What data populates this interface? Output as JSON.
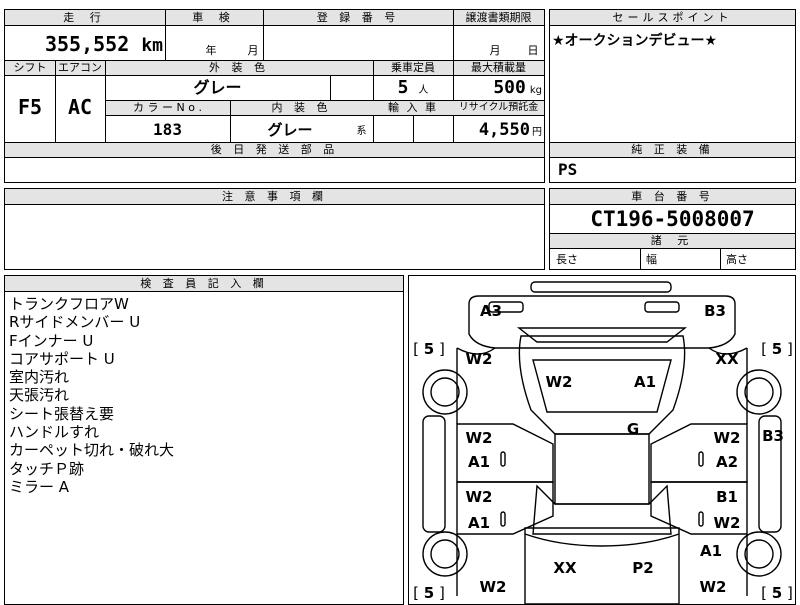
{
  "top_row": {
    "mileage_label": "走 行",
    "inspection_label": "車 検",
    "registration_label": "登 録 番 号",
    "transfer_doc_label": "譲渡書類期限",
    "sales_point_label": "セールスポイント"
  },
  "mileage": {
    "value": "355,552",
    "unit": "km"
  },
  "inspection": {
    "year_unit": "年",
    "month_unit": "月"
  },
  "transfer_doc": {
    "month_unit": "月",
    "day_unit": "日"
  },
  "sales_point": {
    "text": "★オークションデビュー★"
  },
  "row2_labels": {
    "shift": "シフト",
    "aircon": "エアコン",
    "exterior_color": "外 装 色",
    "capacity": "乗車定員",
    "max_load": "最大積載量"
  },
  "shift": {
    "value": "F5"
  },
  "aircon": {
    "value": "AC"
  },
  "exterior_color": {
    "value": "グレー"
  },
  "capacity": {
    "value": "5",
    "unit": "人"
  },
  "max_load": {
    "value": "500",
    "unit": "kg"
  },
  "row3_labels": {
    "color_no": "カ ラ ー N o .",
    "interior_color": "内 装 色",
    "import": "輸 入 車",
    "recycle": "リサイクル預託金"
  },
  "color_no": {
    "value": "183"
  },
  "interior_color": {
    "value": "グレー",
    "suffix": "系"
  },
  "recycle": {
    "value": "4,550",
    "unit": "円"
  },
  "later_parts": {
    "label": "後 日 発 送 部 品"
  },
  "genuine_equipment": {
    "label": "純 正 装 備",
    "value": "PS"
  },
  "notes": {
    "label": "注 意 事 項 欄"
  },
  "chassis": {
    "label": "車 台 番 号",
    "value": "CT196-5008007"
  },
  "dimensions": {
    "label": "諸 元",
    "length": "長さ",
    "width": "幅",
    "height": "高さ"
  },
  "inspector": {
    "label": "検 査 員 記 入 欄",
    "items": [
      "トランクフロアW",
      "Rサイドメンバー U",
      "Fインナー U",
      "コアサポート U",
      "室内汚れ",
      "天張汚れ",
      "シート張替え要",
      "ハンドルすれ",
      "カーペット切れ・破れ大",
      "タッチＰ跡",
      "ミラー A"
    ]
  },
  "diagram": {
    "tire_left_top": "5",
    "tire_right_top": "5",
    "tire_left_bottom": "5",
    "tire_right_bottom": "5",
    "rear_left": "A3",
    "rear_right": "B3",
    "left_rear_fender": "W2",
    "right_rear_fender": "XX",
    "back_left": "W2",
    "back_right": "A1",
    "roof": "G",
    "right_side_b3": "B3",
    "left_rear_door_1": "W2",
    "left_rear_door_2": "A1",
    "right_rear_door_1": "W2",
    "right_rear_door_2": "A2",
    "left_front_door_1": "W2",
    "left_front_door_2": "A1",
    "right_front_door_1": "B1",
    "right_front_door_2": "W2",
    "right_front_fender": "A1",
    "hood_left": "XX",
    "hood_right": "P2",
    "left_front_fender": "W2",
    "right_front_fender_low": "W2"
  }
}
